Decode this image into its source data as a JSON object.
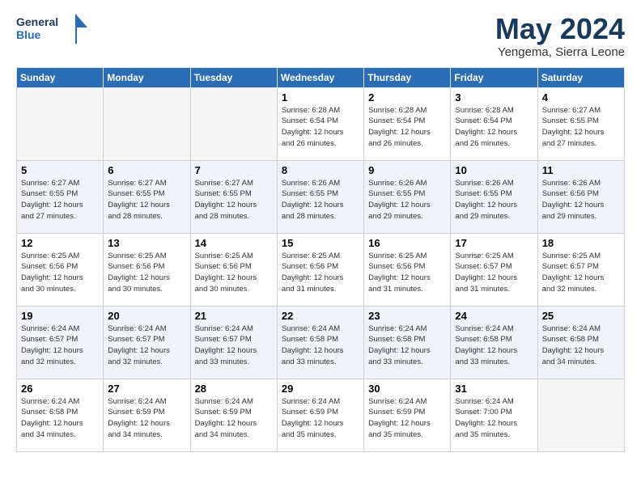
{
  "logo": {
    "line1": "General",
    "line2": "Blue"
  },
  "title": "May 2024",
  "subtitle": "Yengema, Sierra Leone",
  "weekdays": [
    "Sunday",
    "Monday",
    "Tuesday",
    "Wednesday",
    "Thursday",
    "Friday",
    "Saturday"
  ],
  "weeks": [
    [
      {
        "day": "",
        "info": ""
      },
      {
        "day": "",
        "info": ""
      },
      {
        "day": "",
        "info": ""
      },
      {
        "day": "1",
        "info": "Sunrise: 6:28 AM\nSunset: 6:54 PM\nDaylight: 12 hours\nand 26 minutes."
      },
      {
        "day": "2",
        "info": "Sunrise: 6:28 AM\nSunset: 6:54 PM\nDaylight: 12 hours\nand 26 minutes."
      },
      {
        "day": "3",
        "info": "Sunrise: 6:28 AM\nSunset: 6:54 PM\nDaylight: 12 hours\nand 26 minutes."
      },
      {
        "day": "4",
        "info": "Sunrise: 6:27 AM\nSunset: 6:55 PM\nDaylight: 12 hours\nand 27 minutes."
      }
    ],
    [
      {
        "day": "5",
        "info": "Sunrise: 6:27 AM\nSunset: 6:55 PM\nDaylight: 12 hours\nand 27 minutes."
      },
      {
        "day": "6",
        "info": "Sunrise: 6:27 AM\nSunset: 6:55 PM\nDaylight: 12 hours\nand 28 minutes."
      },
      {
        "day": "7",
        "info": "Sunrise: 6:27 AM\nSunset: 6:55 PM\nDaylight: 12 hours\nand 28 minutes."
      },
      {
        "day": "8",
        "info": "Sunrise: 6:26 AM\nSunset: 6:55 PM\nDaylight: 12 hours\nand 28 minutes."
      },
      {
        "day": "9",
        "info": "Sunrise: 6:26 AM\nSunset: 6:55 PM\nDaylight: 12 hours\nand 29 minutes."
      },
      {
        "day": "10",
        "info": "Sunrise: 6:26 AM\nSunset: 6:55 PM\nDaylight: 12 hours\nand 29 minutes."
      },
      {
        "day": "11",
        "info": "Sunrise: 6:26 AM\nSunset: 6:56 PM\nDaylight: 12 hours\nand 29 minutes."
      }
    ],
    [
      {
        "day": "12",
        "info": "Sunrise: 6:25 AM\nSunset: 6:56 PM\nDaylight: 12 hours\nand 30 minutes."
      },
      {
        "day": "13",
        "info": "Sunrise: 6:25 AM\nSunset: 6:56 PM\nDaylight: 12 hours\nand 30 minutes."
      },
      {
        "day": "14",
        "info": "Sunrise: 6:25 AM\nSunset: 6:56 PM\nDaylight: 12 hours\nand 30 minutes."
      },
      {
        "day": "15",
        "info": "Sunrise: 6:25 AM\nSunset: 6:56 PM\nDaylight: 12 hours\nand 31 minutes."
      },
      {
        "day": "16",
        "info": "Sunrise: 6:25 AM\nSunset: 6:56 PM\nDaylight: 12 hours\nand 31 minutes."
      },
      {
        "day": "17",
        "info": "Sunrise: 6:25 AM\nSunset: 6:57 PM\nDaylight: 12 hours\nand 31 minutes."
      },
      {
        "day": "18",
        "info": "Sunrise: 6:25 AM\nSunset: 6:57 PM\nDaylight: 12 hours\nand 32 minutes."
      }
    ],
    [
      {
        "day": "19",
        "info": "Sunrise: 6:24 AM\nSunset: 6:57 PM\nDaylight: 12 hours\nand 32 minutes."
      },
      {
        "day": "20",
        "info": "Sunrise: 6:24 AM\nSunset: 6:57 PM\nDaylight: 12 hours\nand 32 minutes."
      },
      {
        "day": "21",
        "info": "Sunrise: 6:24 AM\nSunset: 6:57 PM\nDaylight: 12 hours\nand 33 minutes."
      },
      {
        "day": "22",
        "info": "Sunrise: 6:24 AM\nSunset: 6:58 PM\nDaylight: 12 hours\nand 33 minutes."
      },
      {
        "day": "23",
        "info": "Sunrise: 6:24 AM\nSunset: 6:58 PM\nDaylight: 12 hours\nand 33 minutes."
      },
      {
        "day": "24",
        "info": "Sunrise: 6:24 AM\nSunset: 6:58 PM\nDaylight: 12 hours\nand 33 minutes."
      },
      {
        "day": "25",
        "info": "Sunrise: 6:24 AM\nSunset: 6:58 PM\nDaylight: 12 hours\nand 34 minutes."
      }
    ],
    [
      {
        "day": "26",
        "info": "Sunrise: 6:24 AM\nSunset: 6:58 PM\nDaylight: 12 hours\nand 34 minutes."
      },
      {
        "day": "27",
        "info": "Sunrise: 6:24 AM\nSunset: 6:59 PM\nDaylight: 12 hours\nand 34 minutes."
      },
      {
        "day": "28",
        "info": "Sunrise: 6:24 AM\nSunset: 6:59 PM\nDaylight: 12 hours\nand 34 minutes."
      },
      {
        "day": "29",
        "info": "Sunrise: 6:24 AM\nSunset: 6:59 PM\nDaylight: 12 hours\nand 35 minutes."
      },
      {
        "day": "30",
        "info": "Sunrise: 6:24 AM\nSunset: 6:59 PM\nDaylight: 12 hours\nand 35 minutes."
      },
      {
        "day": "31",
        "info": "Sunrise: 6:24 AM\nSunset: 7:00 PM\nDaylight: 12 hours\nand 35 minutes."
      },
      {
        "day": "",
        "info": ""
      }
    ]
  ]
}
